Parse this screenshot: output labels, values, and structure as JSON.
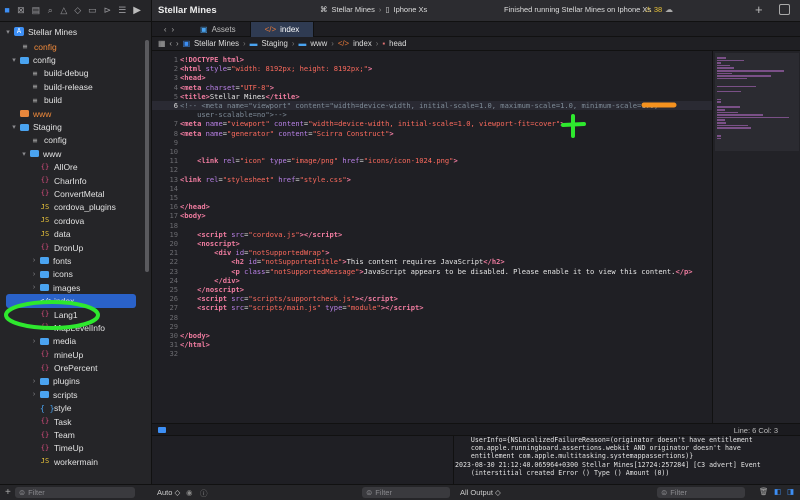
{
  "titlebar": {
    "project": "Stellar Mines",
    "scheme_project": "Stellar Mines",
    "scheme_device": "Iphone Xs",
    "status": "Finished running Stellar Mines on Iphone Xs",
    "warnings": "38"
  },
  "tabs": [
    {
      "label": "Assets",
      "active": false
    },
    {
      "label": "index",
      "active": true
    }
  ],
  "breadcrumb": [
    "Stellar Mines",
    "Staging",
    "www",
    "index",
    "head"
  ],
  "sidebar": {
    "project": "Stellar Mines",
    "items": [
      {
        "label": "config",
        "indent": 1,
        "icon": "config-file",
        "chevron": "",
        "orange": true
      },
      {
        "label": "config",
        "indent": 1,
        "icon": "folder",
        "chevron": "▾"
      },
      {
        "label": "build-debug",
        "indent": 2,
        "icon": "config-file",
        "chevron": ""
      },
      {
        "label": "build-release",
        "indent": 2,
        "icon": "config-file",
        "chevron": ""
      },
      {
        "label": "build",
        "indent": 2,
        "icon": "config-file",
        "chevron": ""
      },
      {
        "label": "www",
        "indent": 1,
        "icon": "folder-orange",
        "chevron": "",
        "orange": true
      },
      {
        "label": "Staging",
        "indent": 1,
        "icon": "folder",
        "chevron": "▾"
      },
      {
        "label": "config",
        "indent": 2,
        "icon": "config-file",
        "chevron": ""
      },
      {
        "label": "www",
        "indent": 2,
        "icon": "folder",
        "chevron": "▾"
      },
      {
        "label": "AllOre",
        "indent": 3,
        "icon": "braces",
        "chevron": ""
      },
      {
        "label": "CharInfo",
        "indent": 3,
        "icon": "braces",
        "chevron": ""
      },
      {
        "label": "ConvertMetal",
        "indent": 3,
        "icon": "braces",
        "chevron": ""
      },
      {
        "label": "cordova_plugins",
        "indent": 3,
        "icon": "js",
        "chevron": ""
      },
      {
        "label": "cordova",
        "indent": 3,
        "icon": "js",
        "chevron": ""
      },
      {
        "label": "data",
        "indent": 3,
        "icon": "js",
        "chevron": ""
      },
      {
        "label": "DronUp",
        "indent": 3,
        "icon": "braces",
        "chevron": ""
      },
      {
        "label": "fonts",
        "indent": 3,
        "icon": "folder",
        "chevron": "›"
      },
      {
        "label": "icons",
        "indent": 3,
        "icon": "folder",
        "chevron": "›"
      },
      {
        "label": "images",
        "indent": 3,
        "icon": "folder",
        "chevron": "›"
      },
      {
        "label": "index",
        "indent": 3,
        "icon": "html",
        "chevron": "",
        "selected": true
      },
      {
        "label": "Lang1",
        "indent": 3,
        "icon": "braces",
        "chevron": ""
      },
      {
        "label": "MapLevelInfo",
        "indent": 3,
        "icon": "braces",
        "chevron": ""
      },
      {
        "label": "media",
        "indent": 3,
        "icon": "folder",
        "chevron": "›"
      },
      {
        "label": "mineUp",
        "indent": 3,
        "icon": "braces",
        "chevron": ""
      },
      {
        "label": "OrePercent",
        "indent": 3,
        "icon": "braces",
        "chevron": ""
      },
      {
        "label": "plugins",
        "indent": 3,
        "icon": "folder",
        "chevron": "›"
      },
      {
        "label": "scripts",
        "indent": 3,
        "icon": "folder",
        "chevron": "›"
      },
      {
        "label": "style",
        "indent": 3,
        "icon": "css",
        "chevron": ""
      },
      {
        "label": "Task",
        "indent": 3,
        "icon": "braces",
        "chevron": ""
      },
      {
        "label": "Team",
        "indent": 3,
        "icon": "braces",
        "chevron": ""
      },
      {
        "label": "TimeUp",
        "indent": 3,
        "icon": "braces",
        "chevron": ""
      },
      {
        "label": "workermain",
        "indent": 3,
        "icon": "js",
        "chevron": ""
      }
    ],
    "filter_placeholder": "Filter"
  },
  "editor": {
    "lines": [
      {
        "n": "1",
        "html": "<span class=\"tg\">&lt;!DOCTYPE html&gt;</span>"
      },
      {
        "n": "2",
        "html": "<span class=\"tg\">&lt;html</span> <span class=\"at\">style</span>=<span class=\"st\">\"width: 8192px; height: 8192px;\"</span><span class=\"tg\">&gt;</span>"
      },
      {
        "n": "3",
        "html": "<span class=\"tg\">&lt;head&gt;</span>"
      },
      {
        "n": "4",
        "html": "<span class=\"tg\">&lt;meta</span> <span class=\"at\">charset</span>=<span class=\"st\">\"UTF-8\"</span><span class=\"tg\">&gt;</span>"
      },
      {
        "n": "5",
        "html": "<span class=\"tg\">&lt;title&gt;</span><span class=\"txt\">Stellar Mines</span><span class=\"tg\">&lt;/title&gt;</span>"
      },
      {
        "n": "6",
        "html": "<span class=\"cm\">&lt;!-- &lt;meta name=\"viewport\" content=\"width=device-width, initial-scale=1.0, maximum-scale=1.0, minimum-scale=1.0,</span>",
        "current": true
      },
      {
        "n": "",
        "html": "<span class=\"cm\">    user-scalable=no\"&gt;--&gt;</span>"
      },
      {
        "n": "7",
        "html": "<span class=\"tg\">&lt;meta</span> <span class=\"at\">name</span>=<span class=\"st\">\"viewport\"</span> <span class=\"at\">content</span>=<span class=\"st\">\"width=device-width, initial-scale=1.0, viewport-fit=cover\"</span><span class=\"tg\">&gt;</span>"
      },
      {
        "n": "8",
        "html": "<span class=\"tg\">&lt;meta</span> <span class=\"at\">name</span>=<span class=\"st\">\"generator\"</span> <span class=\"at\">content</span>=<span class=\"st\">\"Scirra Construct\"</span><span class=\"tg\">&gt;</span>"
      },
      {
        "n": "9",
        "html": ""
      },
      {
        "n": "10",
        "html": ""
      },
      {
        "n": "11",
        "html": "    <span class=\"tg\">&lt;link</span> <span class=\"at\">rel</span>=<span class=\"st\">\"icon\"</span> <span class=\"at\">type</span>=<span class=\"st\">\"image/png\"</span> <span class=\"at\">href</span>=<span class=\"st\">\"icons/icon-1024.png\"</span><span class=\"tg\">&gt;</span>"
      },
      {
        "n": "12",
        "html": ""
      },
      {
        "n": "13",
        "html": "<span class=\"tg\">&lt;link</span> <span class=\"at\">rel</span>=<span class=\"st\">\"stylesheet\"</span> <span class=\"at\">href</span>=<span class=\"st\">\"style.css\"</span><span class=\"tg\">&gt;</span>"
      },
      {
        "n": "14",
        "html": ""
      },
      {
        "n": "15",
        "html": ""
      },
      {
        "n": "16",
        "html": "<span class=\"tg\">&lt;/head&gt;</span>"
      },
      {
        "n": "17",
        "html": "<span class=\"tg\">&lt;body&gt;</span>"
      },
      {
        "n": "18",
        "html": ""
      },
      {
        "n": "19",
        "html": "    <span class=\"tg\">&lt;script</span> <span class=\"at\">src</span>=<span class=\"st\">\"cordova.js\"</span><span class=\"tg\">&gt;&lt;/script&gt;</span>"
      },
      {
        "n": "20",
        "html": "    <span class=\"tg\">&lt;noscript&gt;</span>"
      },
      {
        "n": "21",
        "html": "        <span class=\"tg\">&lt;div</span> <span class=\"at\">id</span>=<span class=\"st\">\"notSupportedWrap\"</span><span class=\"tg\">&gt;</span>"
      },
      {
        "n": "22",
        "html": "            <span class=\"tg\">&lt;h2</span> <span class=\"at\">id</span>=<span class=\"st\">\"notSupportedTitle\"</span><span class=\"tg\">&gt;</span><span class=\"txt\">This content requires JavaScript</span><span class=\"tg\">&lt;/h2&gt;</span>"
      },
      {
        "n": "23",
        "html": "            <span class=\"tg\">&lt;p</span> <span class=\"at\">class</span>=<span class=\"st\">\"notSupportedMessage\"</span><span class=\"tg\">&gt;</span><span class=\"txt\">JavaScript appears to be disabled. Please enable it to view this content.</span><span class=\"tg\">&lt;/p&gt;</span>"
      },
      {
        "n": "24",
        "html": "        <span class=\"tg\">&lt;/div&gt;</span>"
      },
      {
        "n": "25",
        "html": "    <span class=\"tg\">&lt;/noscript&gt;</span>"
      },
      {
        "n": "26",
        "html": "    <span class=\"tg\">&lt;script</span> <span class=\"at\">src</span>=<span class=\"st\">\"scripts/supportcheck.js\"</span><span class=\"tg\">&gt;&lt;/script&gt;</span>"
      },
      {
        "n": "27",
        "html": "    <span class=\"tg\">&lt;script</span> <span class=\"at\">src</span>=<span class=\"st\">\"scripts/main.js\"</span> <span class=\"at\">type</span>=<span class=\"st\">\"module\"</span><span class=\"tg\">&gt;&lt;/script&gt;</span>"
      },
      {
        "n": "28",
        "html": ""
      },
      {
        "n": "29",
        "html": ""
      },
      {
        "n": "30",
        "html": "<span class=\"tg\">&lt;/body&gt;</span>"
      },
      {
        "n": "31",
        "html": "<span class=\"tg\">&lt;/html&gt;</span>"
      },
      {
        "n": "32",
        "html": ""
      }
    ]
  },
  "statusbar": {
    "position": "Line: 6  Col: 3"
  },
  "console": {
    "lines": [
      "    UserInfo={NSLocalizedFailureReason=(originator doesn't have entitlement",
      "    com.apple.runningboard.assertions.webkit AND originator doesn't have",
      "    entitlement com.apple.multitasking.systemappassertions)}",
      "2023-08-30 21:12:40.065964+0300 Stellar Mines[12724:257284] [C3 advert] Event",
      "    (interstitial created Error () Type () Amount (0))"
    ]
  },
  "bottombar": {
    "auto_label": "Auto ◇",
    "filter_left": "Filter",
    "all_output": "All Output ◇",
    "filter_right": "Filter"
  },
  "colors": {
    "accent": "#3d8ff5",
    "highlight_green": "#2ee82e",
    "highlight_orange": "#f5921f"
  }
}
